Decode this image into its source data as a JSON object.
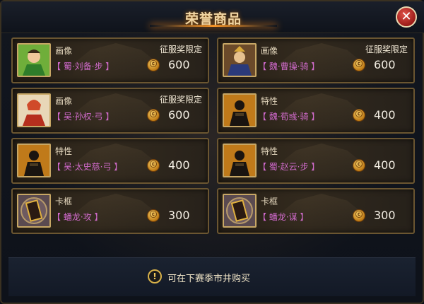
{
  "header": {
    "title": "荣誉商品"
  },
  "close_label": "✕",
  "currency_symbol": "ⓒ",
  "items": [
    {
      "type": "画像",
      "name": "【 蜀·刘备·步 】",
      "limit": "征服奖限定",
      "price": "600",
      "portrait": "liu-bei-portrait"
    },
    {
      "type": "画像",
      "name": "【 魏·曹操·骑 】",
      "limit": "征服奖限定",
      "price": "600",
      "portrait": "cao-cao-portrait"
    },
    {
      "type": "画像",
      "name": "【 吴·孙权·弓 】",
      "limit": "征服奖限定",
      "price": "600",
      "portrait": "sun-quan-portrait"
    },
    {
      "type": "特性",
      "name": "【 魏·荀彧·骑 】",
      "limit": "",
      "price": "400",
      "portrait": "trait-warrior-portrait"
    },
    {
      "type": "特性",
      "name": "【 吴·太史慈·弓 】",
      "limit": "",
      "price": "400",
      "portrait": "trait-warrior-portrait"
    },
    {
      "type": "特性",
      "name": "【 蜀·赵云·步 】",
      "limit": "",
      "price": "400",
      "portrait": "trait-warrior-portrait"
    },
    {
      "type": "卡框",
      "name": "【 蟠龙·攻 】",
      "limit": "",
      "price": "300",
      "portrait": "card-frame-icon"
    },
    {
      "type": "卡框",
      "name": "【 蟠龙·谋 】",
      "limit": "",
      "price": "300",
      "portrait": "card-frame-icon"
    }
  ],
  "footer": {
    "notice": "可在下赛季市井购买",
    "icon": "exclamation-icon"
  },
  "colors": {
    "name_purple": "#d36ad0",
    "border_gold": "#6b5631",
    "accent_orange": "#ff9a2a"
  }
}
